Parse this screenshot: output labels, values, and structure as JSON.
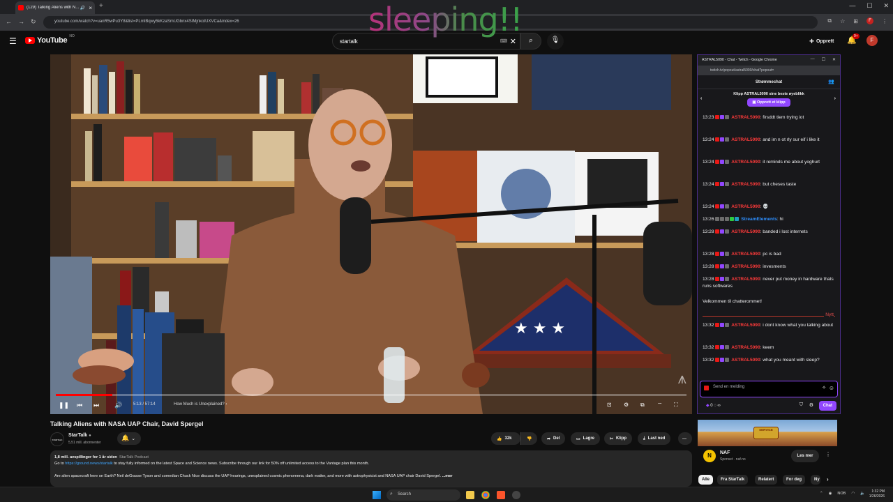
{
  "browser": {
    "tab_title": "(129) Talking Aliens with N...",
    "url": "youtube.com/watch?v=uanR5wPu3Y8&list=PLmIBqwy5kKzaSmUGbnx4SIMjnkotUXVCa&index=26",
    "new_tab": "+",
    "ext_badge": "F"
  },
  "youtube": {
    "logo_text": "YouTube",
    "logo_country": "NO",
    "search_value": "startalk",
    "search_kb": "⌨",
    "create_label": "Opprett",
    "notif_count": "9+",
    "avatar_letter": "F"
  },
  "overlay_text": "sleeping!!",
  "player": {
    "time": "5:13 / 57:14",
    "chapter": "How Much is Unexplained? ›",
    "progress": 0.09
  },
  "video": {
    "title": "Talking Aliens with NASA UAP Chair, David Spergel",
    "channel_name": "StarTalk",
    "channel_avatar_text": "STARTALK",
    "subscribers": "5,51 mill. abonnenter",
    "likes": "32k",
    "share_label": "Del",
    "save_label": "Lagre",
    "clip_label": "Klipp",
    "download_label": "Last ned",
    "stats_line": "1,8 mill. avspillinger  for 1 år siden",
    "podcast_tag": "StarTalk Podcast",
    "desc_line1_prefix": "Go to ",
    "desc_link": "https://ground.news/startalk",
    "desc_line1_suffix": " to stay fully informed on the latest Space and Science news. Subscribe through our link for 50% off unlimited access to the Vantage plan this month.",
    "desc_line2": "Are alien spacecraft here on Earth? Neil deGrasse Tyson and comedian Chuck Nice discuss the UAP hearings, unexplained cosmic phenomena, dark matter, and more with astrophysicist and NASA UAP chair David Spergel.",
    "desc_more": "...mer"
  },
  "chat": {
    "window_title": "ASTRAL5090 - Chat - Twitch - Google Chrome",
    "url": "twitch.tv/popout/astral5090/chat?popout=",
    "header": "Strømmechat",
    "clip_title": "Klipp ASTRAL5090 sine beste øyeblikk",
    "clip_button": "Opprett et klipp",
    "messages": [
      {
        "time": "13:23",
        "user": "ASTRAL5090",
        "text": ": firsddt tiem trying iot"
      },
      {
        "time": "13:24",
        "user": "ASTRAL5090",
        "text": ": and im n ot rly sur eif i like it"
      },
      {
        "time": "13:24",
        "user": "ASTRAL5090",
        "text": ": it reminds me about yoghurt"
      },
      {
        "time": "13:24",
        "user": "ASTRAL5090",
        "text": ": but cheses taste"
      },
      {
        "time": "13:24",
        "user": "ASTRAL5090",
        "text": ": 💀"
      },
      {
        "time": "13:26",
        "user": "StreamElements",
        "text": ": hi"
      },
      {
        "time": "13:28",
        "user": "ASTRAL5090",
        "text": ": banded i lost internets"
      },
      {
        "time": "13:28",
        "user": "ASTRAL5090",
        "text": ": pc is bad"
      },
      {
        "time": "13:28",
        "user": "ASTRAL5090",
        "text": ": invesments"
      },
      {
        "time": "13:28",
        "user": "ASTRAL5090",
        "text": ": never put money in hardware thats runs softwares"
      },
      {
        "time": "13:32",
        "user": "ASTRAL5090",
        "text": ": i dont know what you talking about"
      },
      {
        "time": "13:32",
        "user": "ASTRAL5090",
        "text": ": keem"
      },
      {
        "time": "13:32",
        "user": "ASTRAL5090",
        "text": ": what you meant with sleep?"
      }
    ],
    "welcome": "Velkommen til chatterommet!",
    "new_label": "Nytt",
    "input_placeholder": "Send en melding",
    "points": "0",
    "send_label": "Chat"
  },
  "ad": {
    "name": "NAF",
    "sponsored": "Sponset · naf.no",
    "more_label": "Les mer",
    "sign_text": "SERVICE"
  },
  "chips": [
    "Alle",
    "Fra StarTalk",
    "Relatert",
    "For deg",
    "Ny"
  ],
  "taskbar": {
    "search_label": "Search",
    "lang": "NOB",
    "time": "1:32 PM",
    "date": "1/26/2026"
  },
  "colors": {
    "yt_red": "#ff0000",
    "twitch_purple": "#9147ff",
    "chat_name_red": "#ff3a3a",
    "streamelements_blue": "#2e8fff"
  }
}
